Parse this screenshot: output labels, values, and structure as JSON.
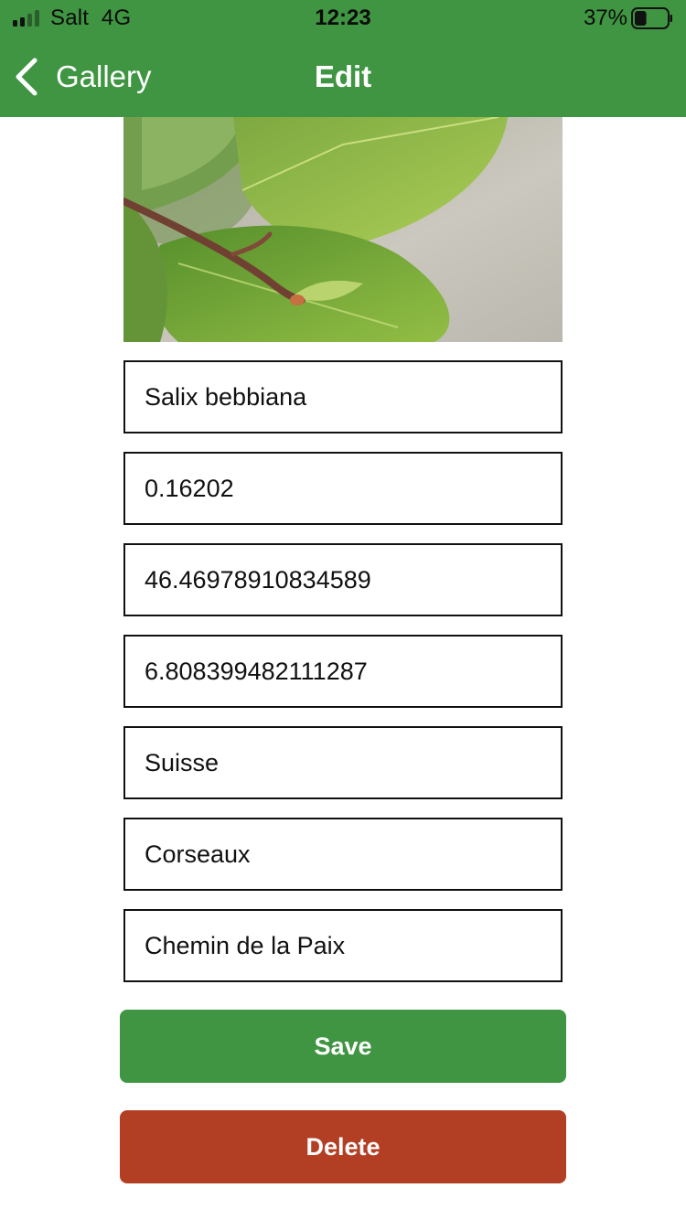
{
  "status_bar": {
    "carrier": "Salt",
    "network": "4G",
    "time": "12:23",
    "battery_percent": "37%",
    "battery_level": 0.37,
    "signal_bars": 2,
    "signal_bars_total": 4
  },
  "nav": {
    "back_label": "Gallery",
    "title": "Edit"
  },
  "photo": {
    "subject": "plant-leaf-photo"
  },
  "fields": {
    "name": "Salix bebbiana",
    "score": "0.16202",
    "latitude": "46.46978910834589",
    "longitude": "6.808399482111287",
    "country": "Suisse",
    "city": "Corseaux",
    "street": "Chemin de la Paix"
  },
  "actions": {
    "save_label": "Save",
    "delete_label": "Delete"
  },
  "colors": {
    "primary": "#3f9541",
    "danger": "#b23f24",
    "field_border": "#111111"
  }
}
